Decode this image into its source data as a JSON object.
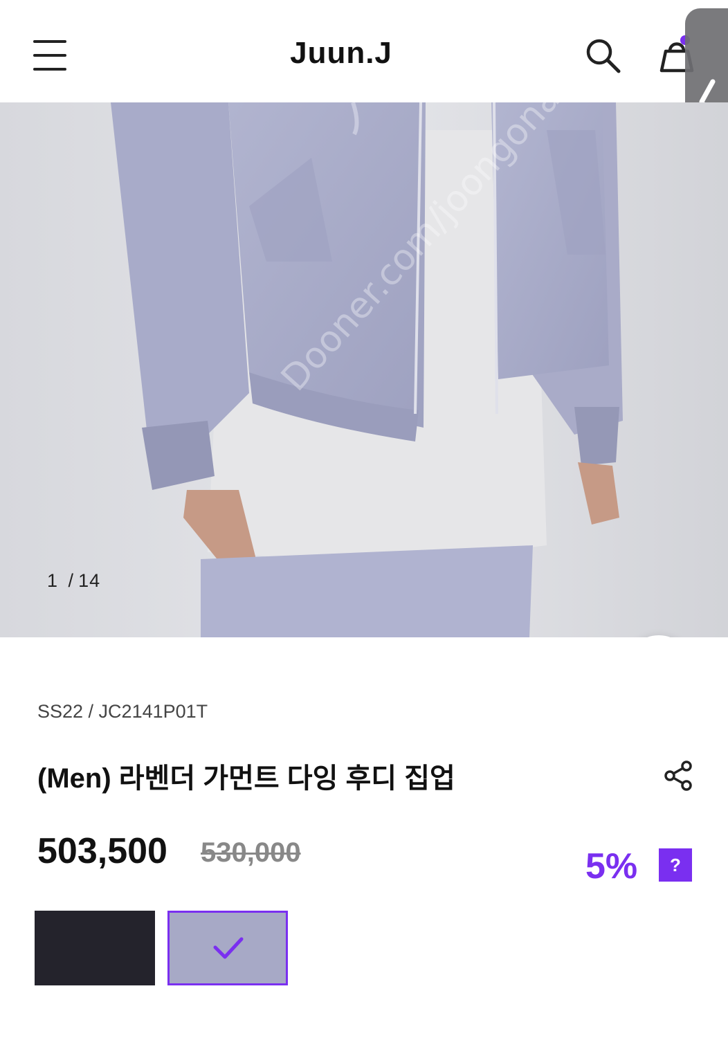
{
  "header": {
    "logo": "Juun.J",
    "icons": {
      "menu": "hamburger-menu-icon",
      "search": "search-icon",
      "cart": "shopping-bag-icon",
      "side_tab": "chevron-left-icon"
    }
  },
  "gallery": {
    "current": "1",
    "separator": "/",
    "total": "14",
    "magic_icon": "magic-wand-icon"
  },
  "product": {
    "code": "SS22 / JC2141P01T",
    "title": "(Men) 라벤더 가먼트 다잉 후디 집업",
    "price": "503,500",
    "original_price": "530,000",
    "discount": "5%",
    "help_label": "?",
    "share_icon": "share-icon"
  },
  "swatches": [
    {
      "color_name": "black",
      "color": "#24232c",
      "selected": false
    },
    {
      "color_name": "lavender",
      "color": "#a7a9c6",
      "selected": true
    }
  ],
  "colors": {
    "accent": "#7a2ff0",
    "text": "#111111",
    "muted": "#888888"
  }
}
